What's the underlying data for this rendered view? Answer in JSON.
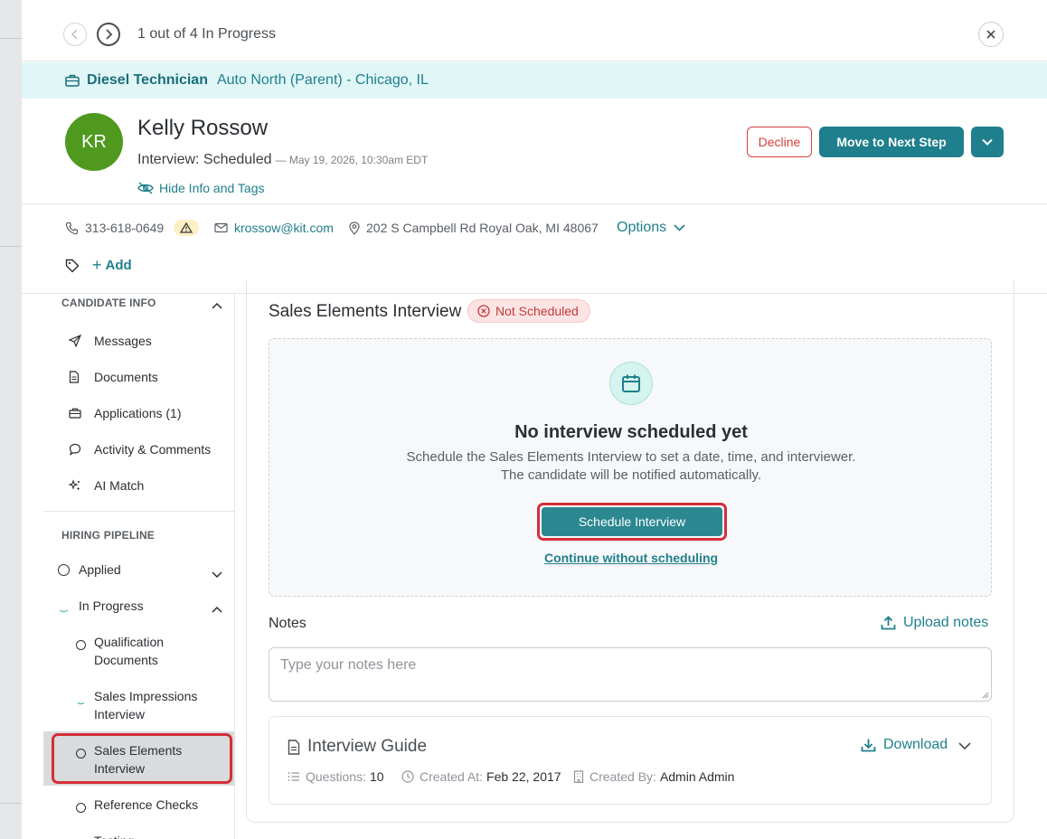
{
  "nav": {
    "counter": "1 out of 4 In Progress"
  },
  "job": {
    "title": "Diesel Technician",
    "location": "Auto North (Parent) - Chicago, IL"
  },
  "candidate": {
    "initials": "KR",
    "name": "Kelly Rossow",
    "stage": "Interview: Scheduled",
    "stage_date": "— May 19, 2026, 10:30am EDT",
    "hide_info": "Hide Info and Tags",
    "phone": "313-618-0649",
    "email": "krossow@kit.com",
    "address": "202 S Campbell Rd Royal Oak, MI 48067",
    "options": "Options",
    "add_tag": "Add",
    "avatar_color": "#4f9a1e"
  },
  "actions": {
    "decline": "Decline",
    "next_step": "Move to Next Step"
  },
  "sidebar": {
    "candidate_info": "CANDIDATE INFO",
    "items": [
      {
        "label": "Messages",
        "icon": "send-icon"
      },
      {
        "label": "Documents",
        "icon": "document-icon"
      },
      {
        "label": "Applications (1)",
        "icon": "briefcase-icon"
      },
      {
        "label": "Activity & Comments",
        "icon": "comment-icon"
      },
      {
        "label": "AI Match",
        "icon": "sparkle-icon"
      }
    ],
    "hiring_pipeline": "HIRING PIPELINE",
    "stages": {
      "applied": "Applied",
      "in_progress": "In Progress",
      "qualification": "Qualification Documents",
      "sales_impressions": "Sales Impressions Interview",
      "sales_elements": "Sales Elements Interview",
      "reference_checks": "Reference Checks",
      "testing": "Testing"
    }
  },
  "main": {
    "section_title": "Sales Elements Interview",
    "status_badge": "Not Scheduled",
    "empty_title": "No interview scheduled yet",
    "empty_desc_1": "Schedule the Sales Elements Interview to set a date, time, and interviewer.",
    "empty_desc_2": "The candidate will be notified automatically.",
    "schedule_button": "Schedule Interview",
    "continue_link": "Continue without scheduling",
    "notes_label": "Notes",
    "upload_notes": "Upload notes",
    "notes_placeholder": "Type your notes here",
    "guide": {
      "title": "Interview Guide",
      "download": "Download",
      "questions_label": "Questions:",
      "questions_value": "10",
      "created_at_label": "Created At:",
      "created_at_value": "Feb 22, 2017",
      "created_by_label": "Created By:",
      "created_by_value": "Admin Admin"
    }
  },
  "colors": {
    "accent": "#1f7f8c",
    "danger": "#d6403c",
    "banner_bg": "#e0f6f7"
  }
}
